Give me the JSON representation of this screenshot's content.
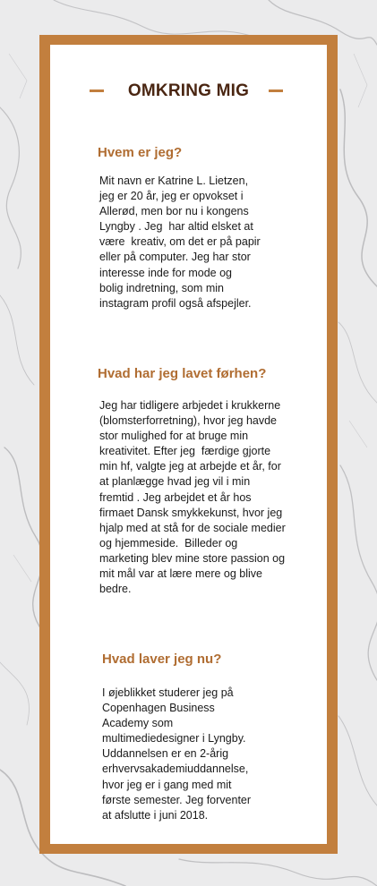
{
  "page": {
    "title": "OMKRING MIG",
    "colors": {
      "frame": "#c27f3e",
      "heading": "#b06d32",
      "title": "#4a2612",
      "background": "marble-grey"
    },
    "sections": [
      {
        "heading": "Hvem er jeg?",
        "body": "Mit navn er Katrine L. Lietzen,\njeg er 20 år, jeg er opvokset i\nAllerød, men bor nu i kongens\nLyngby . Jeg  har altid elsket at\nvære  kreativ, om det er på papir\neller på computer. Jeg har stor\ninteresse inde for mode og\nbolig indretning, som min\ninstagram profil også afspejler."
      },
      {
        "heading": "Hvad har jeg lavet førhen?",
        "body": "Jeg har tidligere arbjedet i krukkerne\n(blomsterforretning), hvor jeg havde\nstor mulighed for at bruge min\nkreativitet. Efter jeg  færdige gjorte\nmin hf, valgte jeg at arbejde et år, for\nat planlægge hvad jeg vil i min\nfremtid . Jeg arbejdet et år hos\nfirmaet Dansk smykkekunst, hvor jeg\nhjalp med at stå for de sociale medier\nog hjemmeside.  Billeder og\nmarketing blev mine store passion og\nmit mål var at lære mere og blive\nbedre."
      },
      {
        "heading": "Hvad laver jeg nu?",
        "body": "I øjeblikket studerer jeg på\nCopenhagen Business\nAcademy som\nmultimediedesigner i Lyngby.\nUddannelsen er en 2-årig\nerhvervsakademiuddannelse,\nhvor jeg er i gang med mit\nførste semester. Jeg forventer\nat afslutte i juni 2018."
      }
    ]
  }
}
